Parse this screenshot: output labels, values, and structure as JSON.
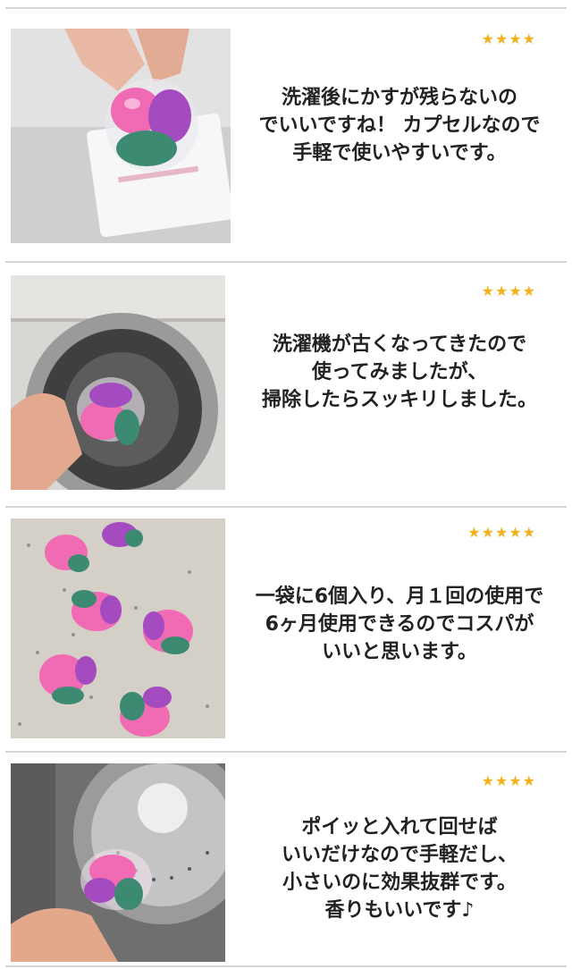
{
  "reviews": [
    {
      "stars": "★★★★",
      "rating": 4,
      "text": "洗濯後にかすが残らないの\nでいいですね！ カプセルなので\n手軽で使いやすいです。",
      "image": "hand-holding-capsule-photo"
    },
    {
      "stars": "★★★★",
      "rating": 4,
      "text": "洗濯機が古くなってきたので\n使ってみましたが、\n掃除したらスッキリしました。",
      "image": "capsule-at-washing-machine-photo"
    },
    {
      "stars": "★★★★★",
      "rating": 5,
      "text": "一袋に6個入り、月１回の使用で\n6ヶ月使用できるのでコスパが\nいいと思います。",
      "image": "capsules-on-counter-photo"
    },
    {
      "stars": "★★★★",
      "rating": 4,
      "text": "ポイッと入れて回せば\nいいだけなので手軽だし、\n小さいのに効果抜群です。\n香りもいいです♪",
      "image": "capsule-into-drum-photo"
    }
  ],
  "colors": {
    "star": "#f1b21d",
    "divider": "#d5d5d5",
    "capsule_pink": "#f06bb3",
    "capsule_purple": "#a54bc0",
    "capsule_green": "#3d8a73"
  }
}
